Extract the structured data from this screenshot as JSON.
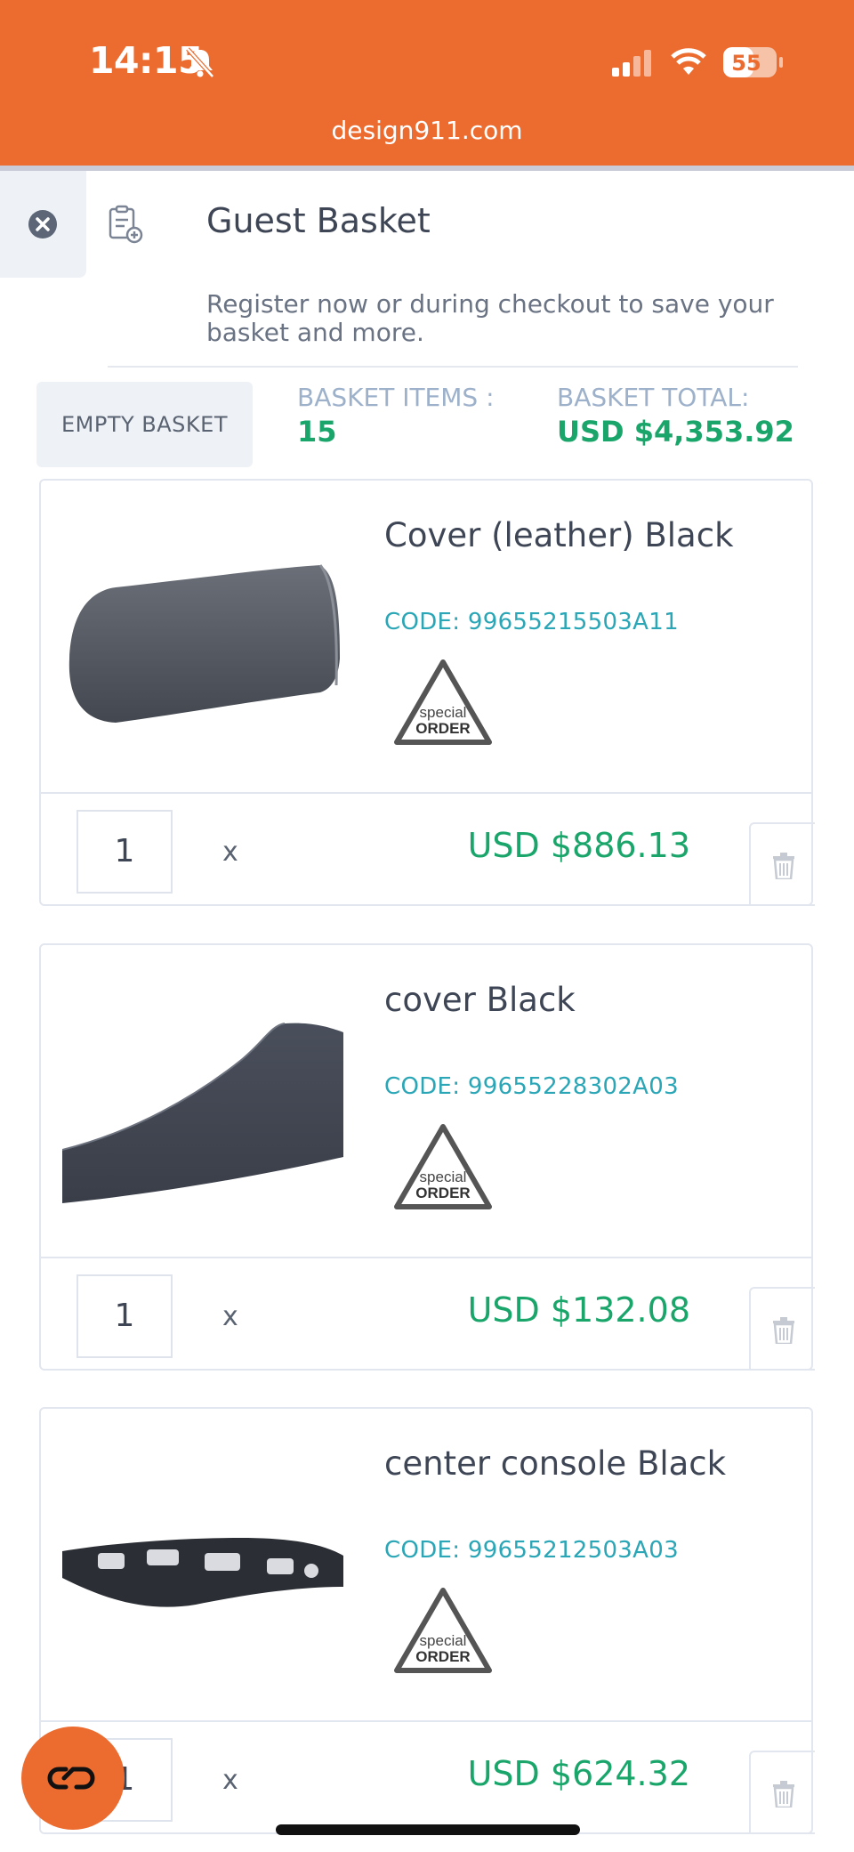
{
  "status_bar": {
    "time": "14:15",
    "battery": "55",
    "url": "design911.com"
  },
  "header": {
    "title": "Guest Basket",
    "subtitle": "Register now or during checkout to save your basket and more."
  },
  "summary": {
    "empty_label": "EMPTY BASKET",
    "items_label": "BASKET ITEMS :",
    "items_value": "15",
    "total_label": "BASKET TOTAL:",
    "total_value": "USD $4,353.92"
  },
  "items": [
    {
      "name": "Cover (leather) Black",
      "code": "CODE: 99655215503A11",
      "badge": "special ORDER",
      "qty": "1",
      "times": "x",
      "price": "USD $886.13"
    },
    {
      "name": "cover Black",
      "code": "CODE: 99655228302A03",
      "badge": "special ORDER",
      "qty": "1",
      "times": "x",
      "price": "USD $132.08"
    },
    {
      "name": "center console Black",
      "code": "CODE: 99655212503A03",
      "badge": "special ORDER",
      "qty": "1",
      "times": "x",
      "price": "USD $624.32"
    }
  ],
  "colors": {
    "brand": "#ec6c30",
    "price": "#1aa56a",
    "code": "#2aa6b6"
  }
}
